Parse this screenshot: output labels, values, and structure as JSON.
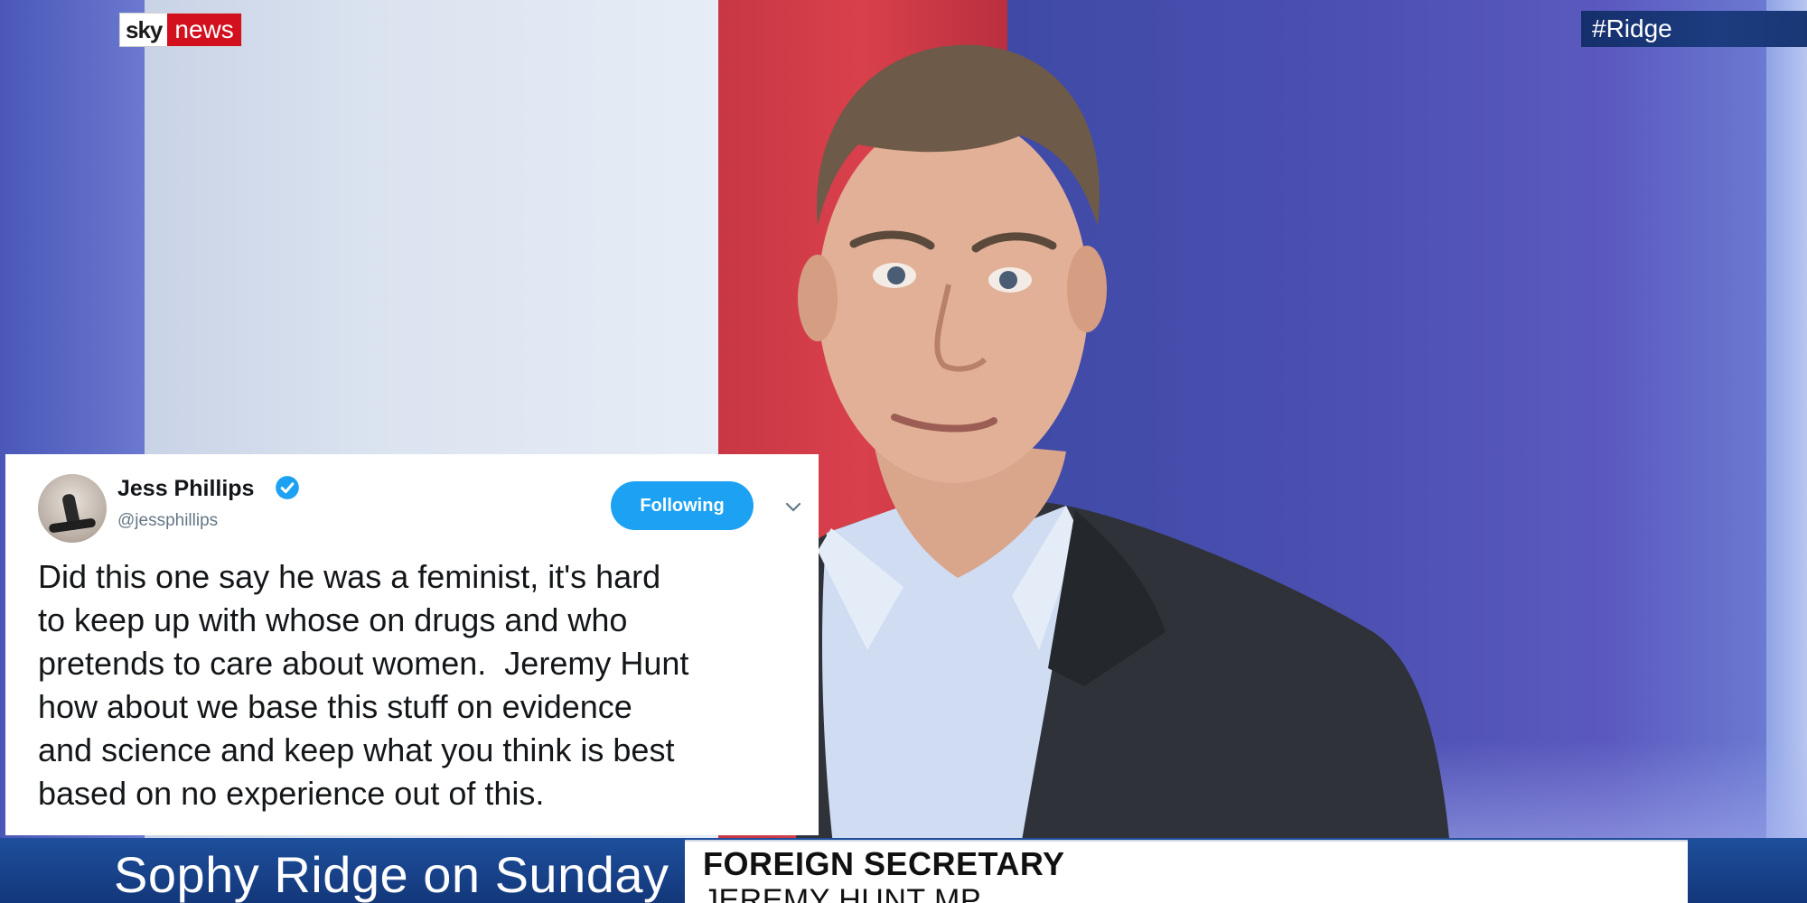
{
  "broadcast": {
    "logo": {
      "sky": "sky",
      "news": "news"
    },
    "hashtag": "#Ridge",
    "show_title": "Sophy Ridge on Sunday",
    "caption": {
      "line1": "FOREIGN SECRETARY",
      "line2": "JEREMY HUNT MP"
    }
  },
  "tweet": {
    "author_name": "Jess Phillips",
    "author_handle": "@jessphillips",
    "verified": true,
    "follow_label": "Following",
    "text": "Did this one say he was a feminist, it's hard\nto keep up with whose on drugs and who\npretends to care about women.  Jeremy Hunt\nhow about we base this stuff on evidence\nand science and keep what you think is best\nbased on no experience out of this."
  },
  "colors": {
    "sky_red": "#d2101e",
    "twitter_blue": "#1da1f2",
    "lower_bar_blue": "#13377a",
    "studio_red": "#d9404b",
    "studio_blue": "#4b4fb0"
  },
  "icons": {
    "verified": "verified-badge-icon",
    "chevron": "chevron-down-icon"
  }
}
